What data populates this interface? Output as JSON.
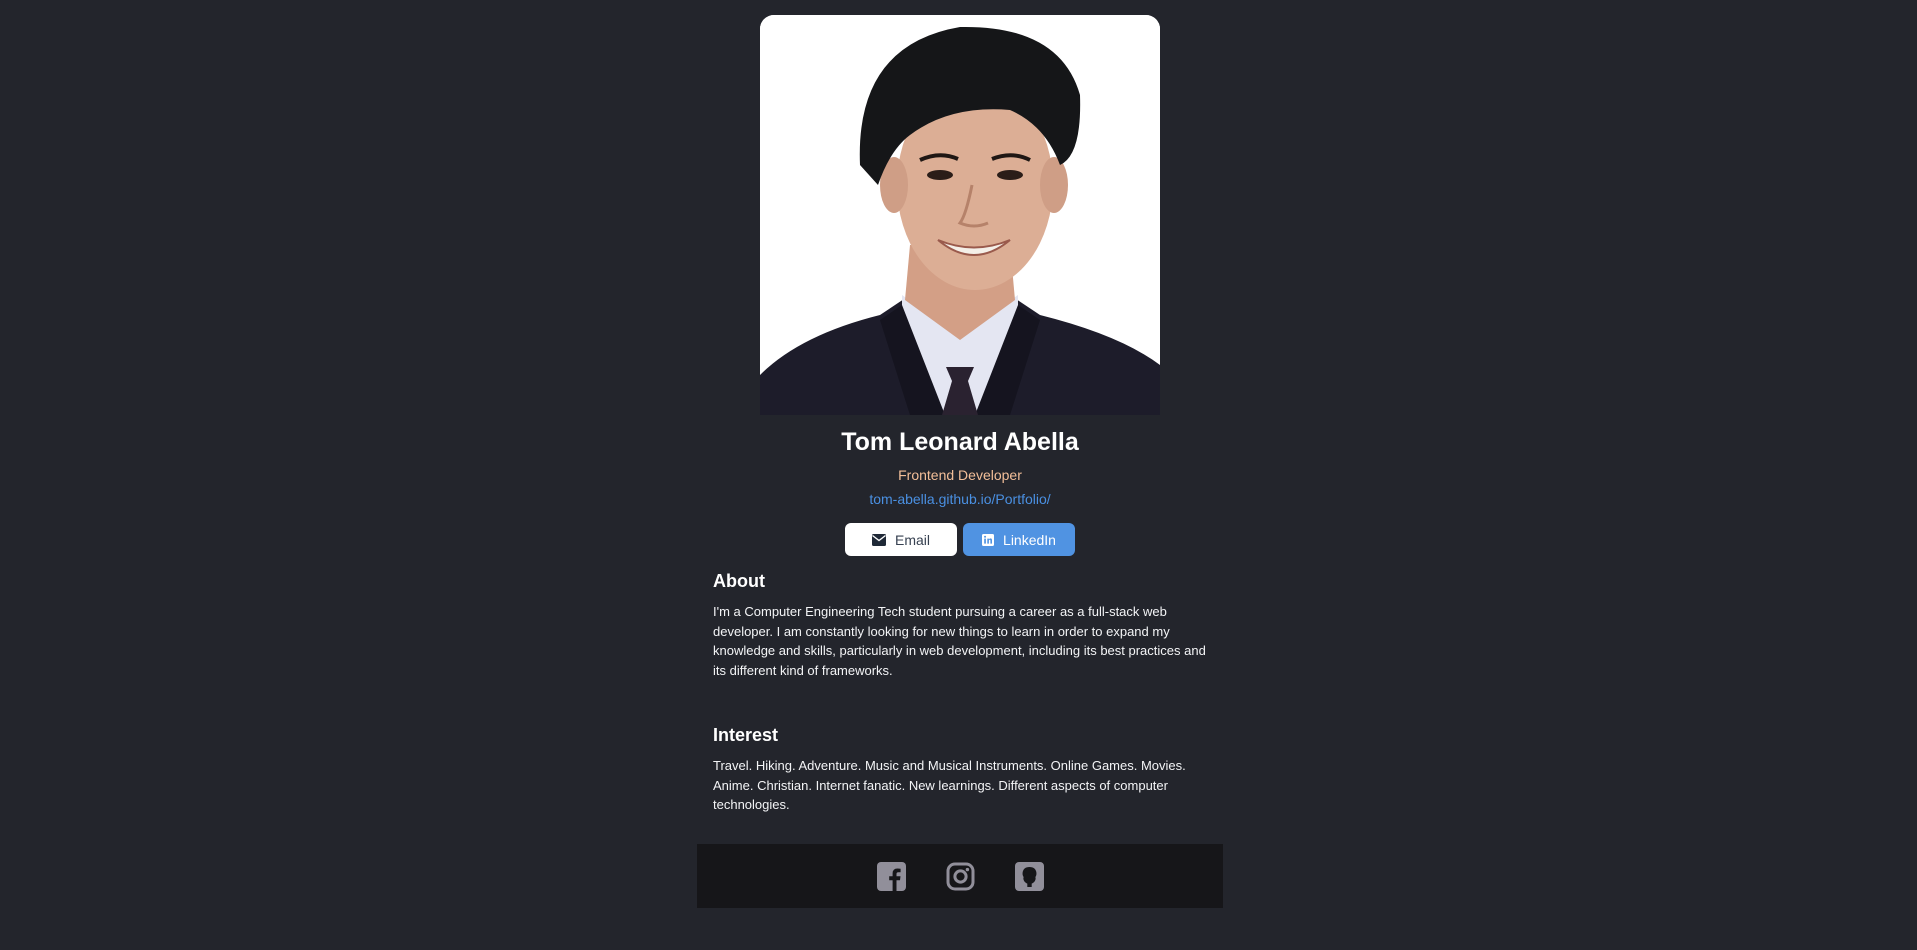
{
  "profile": {
    "name": "Tom Leonard Abella",
    "role": "Frontend Developer",
    "website": "tom-abella.github.io/Portfolio/"
  },
  "buttons": {
    "email": {
      "label": "Email",
      "icon": "envelope-icon"
    },
    "linkedin": {
      "label": "LinkedIn",
      "icon": "linkedin-icon"
    }
  },
  "about": {
    "heading": "About",
    "text": "I'm a Computer Engineering Tech student pursuing a career as a full-stack web developer. I am constantly looking for new things to learn in order to expand my knowledge and skills, particularly in web development, including its best practices and its different kind of frameworks."
  },
  "interest": {
    "heading": "Interest",
    "text": "Travel. Hiking. Adventure. Music and Musical Instruments. Online Games. Movies. Anime. Christian. Internet fanatic. New learnings. Different aspects of computer technologies."
  },
  "footer": {
    "icons": [
      "facebook-icon",
      "instagram-icon",
      "github-icon"
    ]
  },
  "colors": {
    "background": "#23252c",
    "footer": "#161619",
    "role": "#f3bf99",
    "link": "#4a90e2",
    "linkedin_button": "#5093e2",
    "social_icon": "#918f9a"
  }
}
